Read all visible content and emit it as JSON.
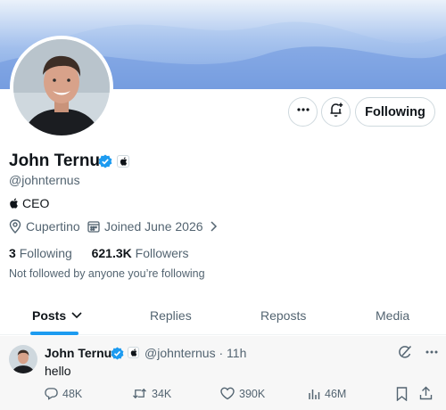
{
  "profile": {
    "name": "John Ternus",
    "handle": "@johnternus",
    "bio": "CEO",
    "location": "Cupertino",
    "joined": "Joined June 2026",
    "following_count": "3",
    "following_label": "Following",
    "followers_count": "621.3K",
    "followers_label": "Followers",
    "not_followed_text": "Not followed by anyone you’re following"
  },
  "actions": {
    "follow_button_label": "Following"
  },
  "tabs": [
    {
      "label": "Posts"
    },
    {
      "label": "Replies"
    },
    {
      "label": "Reposts"
    },
    {
      "label": "Media"
    }
  ],
  "post": {
    "author_name": "John Ternus",
    "author_handle": "@johnternus · 11h",
    "text": "hello",
    "replies": "48K",
    "reposts": "34K",
    "likes": "390K",
    "views": "46M"
  },
  "colors": {
    "accent": "#1d9bf0",
    "verified": "#1d9bf0",
    "text_secondary": "#536471"
  },
  "icons": {
    "more": "more-icon",
    "notify": "bell-plus-icon",
    "verified": "verified-badge-icon",
    "apple": "apple-logo-icon",
    "location": "location-pin-icon",
    "calendar": "calendar-icon",
    "chevron": "chevron-right-icon",
    "reply": "reply-icon",
    "repost": "repost-icon",
    "like": "heart-icon",
    "views": "views-icon",
    "bookmark": "bookmark-icon",
    "share": "share-icon",
    "grok": "grok-icon"
  }
}
